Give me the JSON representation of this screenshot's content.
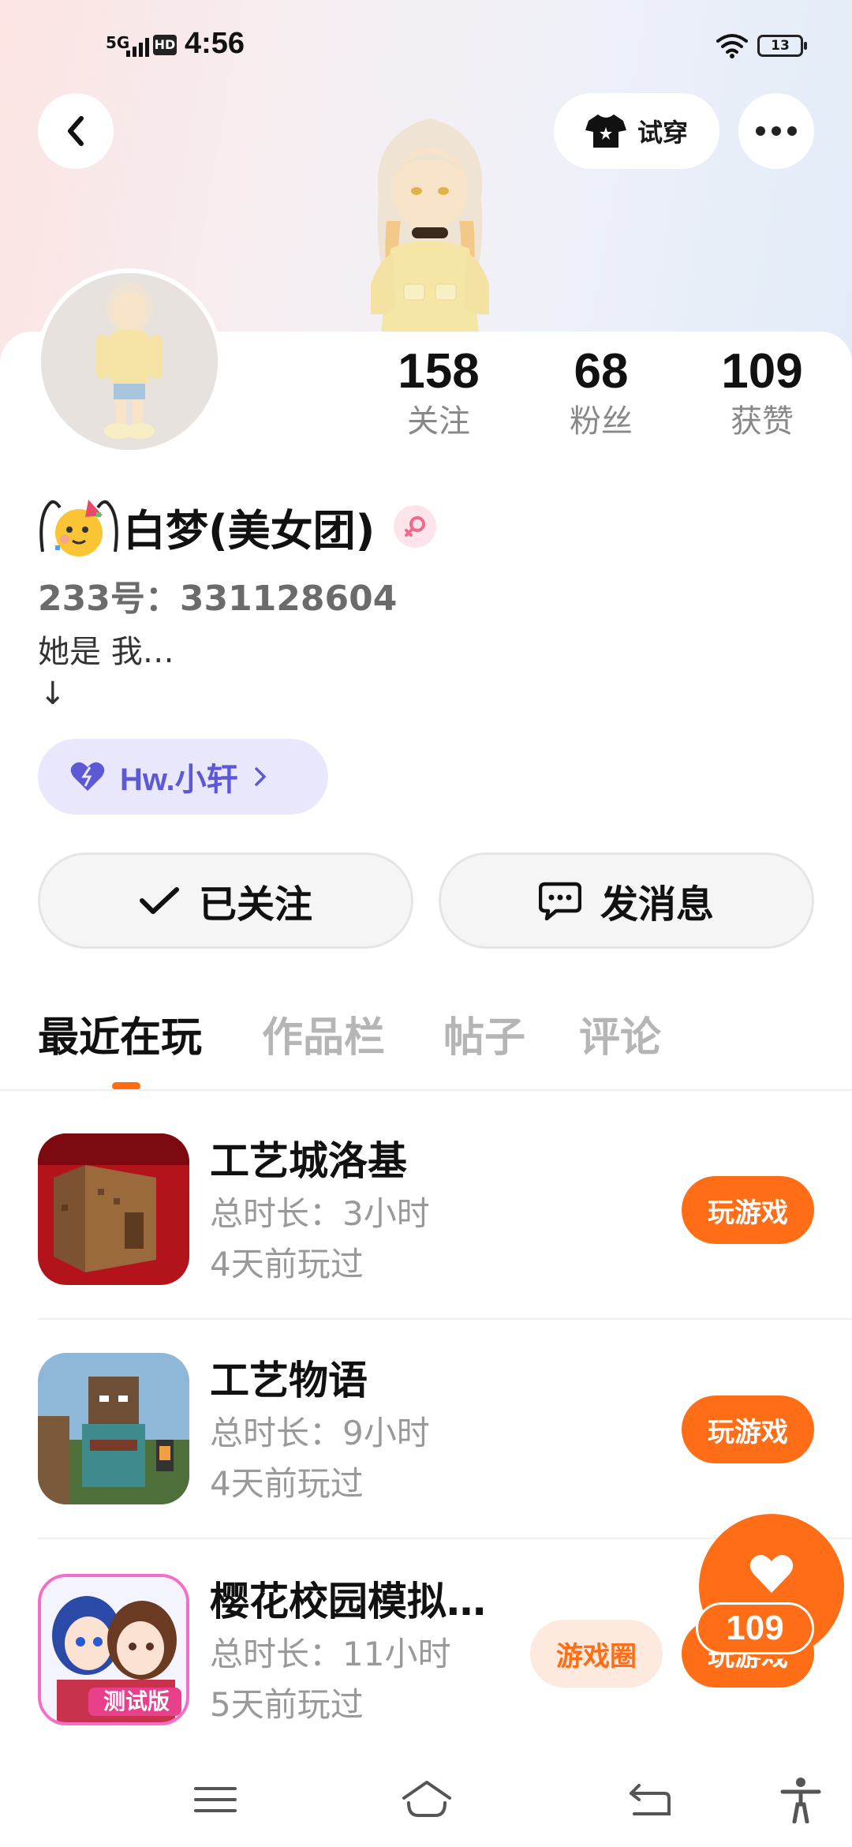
{
  "status_bar": {
    "network": "5G",
    "hd": "HD",
    "time": "4:56",
    "battery": "13"
  },
  "header": {
    "try_on_label": "试穿"
  },
  "stats": [
    {
      "value": "158",
      "label": "关注"
    },
    {
      "value": "68",
      "label": "粉丝"
    },
    {
      "value": "109",
      "label": "获赞"
    }
  ],
  "profile": {
    "name": "白梦(美女团)",
    "uid": "233号：331128604",
    "bio_line": "她是 我…",
    "bio_arrow": "↓",
    "relation_tag": "Hw.小轩"
  },
  "actions": {
    "following_label": "已关注",
    "message_label": "发消息"
  },
  "tabs": [
    "最近在玩",
    "作品栏",
    "帖子",
    "评论"
  ],
  "games": [
    {
      "title": "工艺城洛基",
      "duration": "总时长：3小时",
      "last_played": "4天前玩过",
      "button": "玩游戏"
    },
    {
      "title": "工艺物语",
      "duration": "总时长：9小时",
      "last_played": "4天前玩过",
      "button": "玩游戏"
    },
    {
      "title": "樱花校园模拟…",
      "duration": "总时长：11小时",
      "last_played": "5天前玩过",
      "button": "玩游戏",
      "secondary_button": "游戏圈",
      "icon_badge": "测试版"
    }
  ],
  "like_fab": {
    "count": "109"
  },
  "colors": {
    "accent": "#ff6d16",
    "tag_text": "#5d58d6",
    "tag_bg": "#e9e7fb"
  }
}
